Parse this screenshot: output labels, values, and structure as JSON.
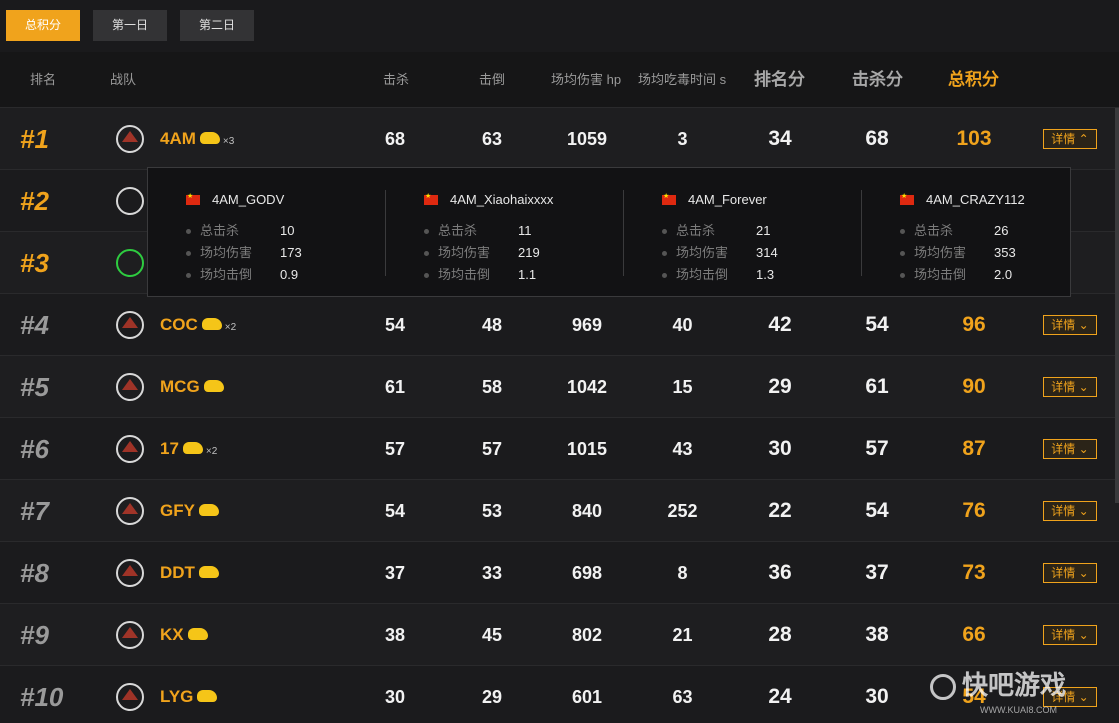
{
  "tabs": [
    "总积分",
    "第一日",
    "第二日"
  ],
  "headers": {
    "rank": "排名",
    "team": "战队",
    "kills": "击杀",
    "downs": "击倒",
    "avg_damage": "场均伤害 hp",
    "avg_poison_time": "场均吃毒时间 s",
    "rank_points": "排名分",
    "kill_points": "击杀分",
    "total_points": "总积分"
  },
  "detail_label": "详情",
  "rows": [
    {
      "rank": "#1",
      "team": "4AM",
      "chickens": "×3",
      "kills": "68",
      "downs": "63",
      "damage": "1059",
      "time": "3",
      "rp": "34",
      "kp": "68",
      "total": "103"
    },
    {
      "rank": "#2",
      "team": "",
      "chickens": "",
      "kills": "",
      "downs": "",
      "damage": "",
      "time": "",
      "rp": "",
      "kp": "",
      "total": ""
    },
    {
      "rank": "#3",
      "team": "",
      "chickens": "",
      "kills": "",
      "downs": "",
      "damage": "",
      "time": "",
      "rp": "",
      "kp": "",
      "total": ""
    },
    {
      "rank": "#4",
      "team": "COC",
      "chickens": "×2",
      "kills": "54",
      "downs": "48",
      "damage": "969",
      "time": "40",
      "rp": "42",
      "kp": "54",
      "total": "96"
    },
    {
      "rank": "#5",
      "team": "MCG",
      "chickens": "",
      "kills": "61",
      "downs": "58",
      "damage": "1042",
      "time": "15",
      "rp": "29",
      "kp": "61",
      "total": "90"
    },
    {
      "rank": "#6",
      "team": "17",
      "chickens": "×2",
      "kills": "57",
      "downs": "57",
      "damage": "1015",
      "time": "43",
      "rp": "30",
      "kp": "57",
      "total": "87"
    },
    {
      "rank": "#7",
      "team": "GFY",
      "chickens": "",
      "kills": "54",
      "downs": "53",
      "damage": "840",
      "time": "252",
      "rp": "22",
      "kp": "54",
      "total": "76"
    },
    {
      "rank": "#8",
      "team": "DDT",
      "chickens": "",
      "kills": "37",
      "downs": "33",
      "damage": "698",
      "time": "8",
      "rp": "36",
      "kp": "37",
      "total": "73"
    },
    {
      "rank": "#9",
      "team": "KX",
      "chickens": "",
      "kills": "38",
      "downs": "45",
      "damage": "802",
      "time": "21",
      "rp": "28",
      "kp": "38",
      "total": "66"
    },
    {
      "rank": "#10",
      "team": "LYG",
      "chickens": "",
      "kills": "30",
      "downs": "29",
      "damage": "601",
      "time": "63",
      "rp": "24",
      "kp": "30",
      "total": "54"
    }
  ],
  "popup": {
    "stat_labels": [
      "总击杀",
      "场均伤害",
      "场均击倒"
    ],
    "players": [
      {
        "name": "4AM_GODV",
        "kills": "10",
        "damage": "173",
        "downs": "0.9"
      },
      {
        "name": "4AM_Xiaohaixxxx",
        "kills": "11",
        "damage": "219",
        "downs": "1.1"
      },
      {
        "name": "4AM_Forever",
        "kills": "21",
        "damage": "314",
        "downs": "1.3"
      },
      {
        "name": "4AM_CRAZY112",
        "kills": "26",
        "damage": "353",
        "downs": "2.0"
      }
    ]
  },
  "watermark": {
    "text": "快吧游戏",
    "url": "WWW.KUAI8.COM"
  },
  "colors": {
    "accent": "#f0a31c",
    "background": "#1c1c1e",
    "chicken": "#f5c518"
  }
}
